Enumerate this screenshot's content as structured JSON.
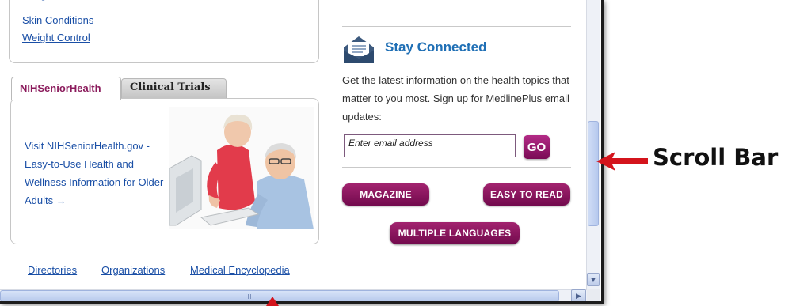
{
  "left_top_box": {
    "links": [
      "Skin Conditions",
      "Weight Control"
    ]
  },
  "senior_section": {
    "tabs": [
      "NIHSeniorHealth",
      "Clinical Trials"
    ],
    "promo_text": "Visit NIHSeniorHealth.gov - Easy-to-Use Health and Wellness Information for Older Adults →"
  },
  "stay_connected": {
    "title": "Stay Connected",
    "description": "Get the latest information on the health topics that matter to you most. Sign up for MedlinePlus email updates:",
    "email_placeholder": "Enter email address",
    "go_label": "GO"
  },
  "buttons": {
    "magazine": "MAGAZINE",
    "easy_to_read": "EASY TO READ",
    "multiple_languages": "MULTIPLE LANGUAGES"
  },
  "footer_links": [
    "Directories",
    "Organizations",
    "Medical Encyclopedia"
  ],
  "annotation": {
    "label": "Scroll Bar"
  },
  "colors": {
    "link": "#1a4fa6",
    "accent_magenta": "#8b1b5c",
    "button_gradient_top": "#a2236f",
    "button_gradient_bottom": "#720a4d",
    "title_blue": "#1f6fb5",
    "arrow_red": "#d4141c"
  }
}
